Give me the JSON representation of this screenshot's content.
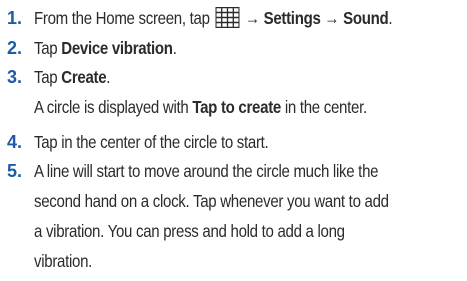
{
  "steps": [
    {
      "num": "1.",
      "pre": "From the Home screen, tap ",
      "icon": "apps-grid-icon",
      "arrow1": " → ",
      "b1": "Settings",
      "arrow2": " → ",
      "b2": "Sound",
      "end": "."
    },
    {
      "num": "2.",
      "pre": "Tap ",
      "b1": "Device vibration",
      "end": "."
    },
    {
      "num": "3.",
      "pre": "Tap ",
      "b1": "Create",
      "end": ".",
      "sub_pre": "A circle is displayed with ",
      "sub_b": "Tap to create",
      "sub_end": " in the center."
    },
    {
      "num": "4.",
      "line1": "Tap in the center of the circle to start."
    },
    {
      "num": "5.",
      "lines": [
        "A line will start to move around the circle much like the",
        "second hand on a clock. Tap whenever you want to add",
        "a vibration. You can press and hold to add a long",
        "vibration."
      ]
    }
  ],
  "colors": {
    "step_number": "#1f5aa6",
    "text": "#2b2b2b"
  }
}
